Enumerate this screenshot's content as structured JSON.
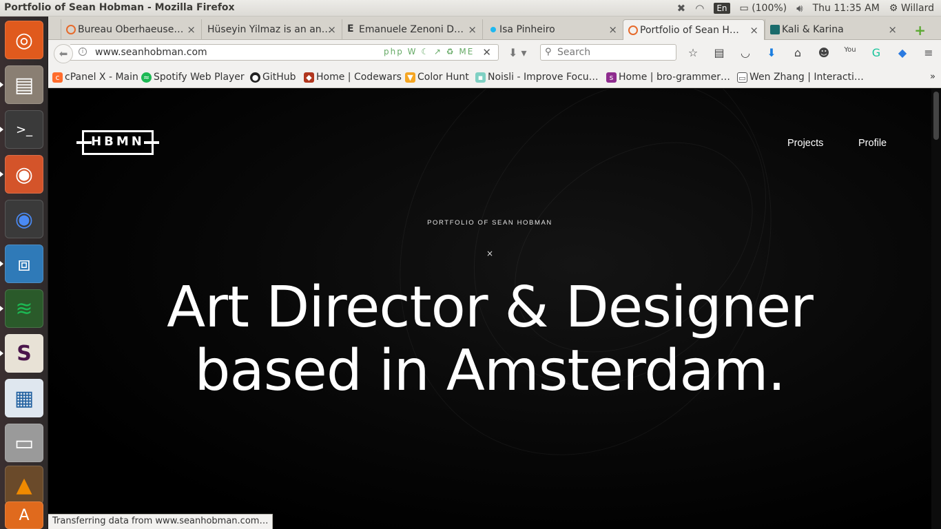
{
  "system": {
    "window_title": "Portfolio of Sean Hobman - Mozilla Firefox",
    "keyboard": "En",
    "battery": "(100%)",
    "clock": "Thu 11:35 AM",
    "user": "Willard"
  },
  "launcher": {
    "apps": [
      "Ubuntu Dash",
      "Files",
      "Terminal",
      "Firefox",
      "Chrome",
      "Brackets",
      "Spotify",
      "Slack",
      "LibreOffice Impress",
      "Disks",
      "VLC",
      "Software Center"
    ]
  },
  "tabs": [
    {
      "title": "Bureau Oberhaeuse…",
      "favicon_color": "#e66a2b"
    },
    {
      "title": "Hüseyin Yilmaz is an an…",
      "favicon_color": "#d6d3cc"
    },
    {
      "title": "Emanuele Zenoni D…",
      "favicon_color": "#222222"
    },
    {
      "title": "Isa Pinheiro",
      "favicon_color": "#1fb8f0"
    },
    {
      "title": "Portfolio of Sean H…",
      "favicon_color": "#e66a2b"
    },
    {
      "title": "Kali & Karina",
      "favicon_color": "#1a6b6b"
    }
  ],
  "navbar": {
    "url": "www.seanhobman.com",
    "search_placeholder": "Search",
    "addons": "php W ☾ ↗ ♻ ME"
  },
  "bookmarks": [
    {
      "label": "cPanel X - Main",
      "icon_color": "#ff6c2c",
      "icon_char": "c"
    },
    {
      "label": "Spotify Web Player",
      "icon_color": "#1db954",
      "icon_char": "≈"
    },
    {
      "label": "GitHub",
      "icon_color": "#222222",
      "icon_char": "●"
    },
    {
      "label": "Home | Codewars",
      "icon_color": "#b1361e",
      "icon_char": "◆"
    },
    {
      "label": "Color Hunt",
      "icon_color": "#f5a623",
      "icon_char": "▼"
    },
    {
      "label": "Noisli - Improve Focu…",
      "icon_color": "#7fd0c3",
      "icon_char": "▪"
    },
    {
      "label": "Home | bro-grammer…",
      "icon_color": "#8e2c8e",
      "icon_char": "s"
    },
    {
      "label": "Wen Zhang | Interacti…",
      "icon_color": "#555555",
      "icon_char": "▭"
    }
  ],
  "site": {
    "logo": "HBMN",
    "nav": {
      "projects": "Projects",
      "profile": "Profile"
    },
    "kicker": "PORTFOLIO OF SEAN HOBMAN",
    "separator": "×",
    "headline_line1": "Art Director & Designer",
    "headline_line2": "based in Amsterdam."
  },
  "status": "Transferring data from www.seanhobman.com…"
}
